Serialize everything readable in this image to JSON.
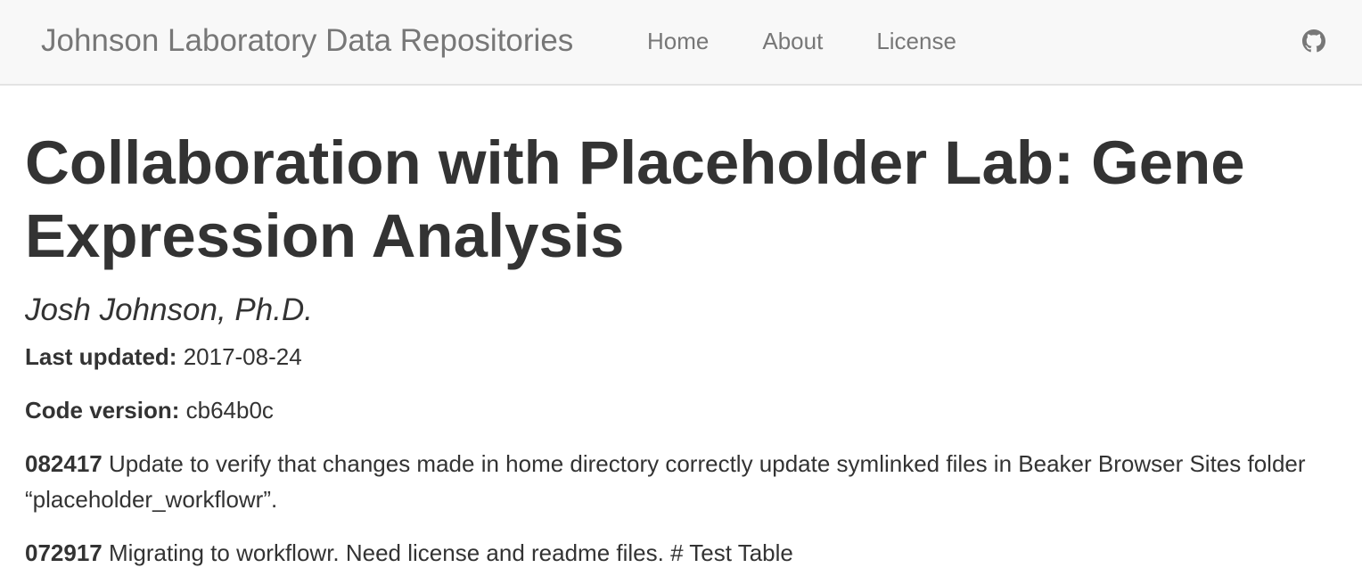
{
  "navbar": {
    "brand": "Johnson Laboratory Data Repositories",
    "links": [
      "Home",
      "About",
      "License"
    ],
    "right_icon": "github-icon"
  },
  "main": {
    "title": "Collaboration with Placeholder Lab: Gene Expression Analysis",
    "author": "Josh Johnson, Ph.D.",
    "last_updated_label": "Last updated:",
    "last_updated_value": "2017-08-24",
    "code_version_label": "Code version:",
    "code_version_value": "cb64b0c",
    "notes": [
      {
        "id": "082417",
        "text": "Update to verify that changes made in home directory correctly update symlinked files in Beaker Browser Sites folder “placeholder_workflowr”."
      },
      {
        "id": "072917",
        "text": "Migrating to workflowr. Need license and readme files. # Test Table"
      }
    ]
  },
  "colors": {
    "navbar_bg": "#f8f8f8",
    "nav_text": "#777777",
    "body_text": "#333333"
  }
}
